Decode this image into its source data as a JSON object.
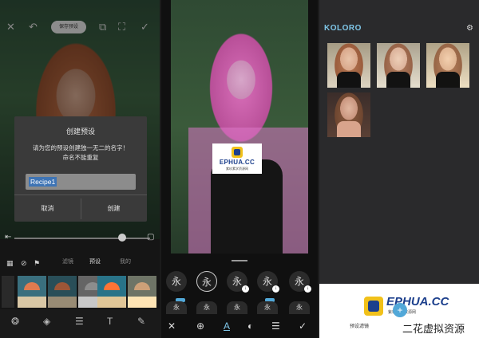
{
  "panel1": {
    "save_preset_pill": "保存预设",
    "dialog": {
      "title": "创建预设",
      "message_line1": "请为您的预设创建独一无二的名字！",
      "message_line2": "命名不能重复",
      "input_value": "Recipe1",
      "cancel_label": "取消",
      "create_label": "创建"
    },
    "tabs": [
      "滤镜",
      "预设",
      "我的"
    ]
  },
  "panel2": {
    "watermark": {
      "text": "EPHUA.CC",
      "sub": "紫玖素学资源网"
    },
    "fonts_row1": [
      "永",
      "永",
      "永",
      "永",
      "永"
    ],
    "fonts_row2": [
      "永",
      "永",
      "永",
      "永",
      "永"
    ]
  },
  "panel3": {
    "app_title": "KOLORO",
    "promo": {
      "text": "EPHUA.CC",
      "sub": "紫玖素学资源网",
      "button_label": "预设滤镜",
      "credit": "二花虚拟资源"
    }
  },
  "colors": {
    "accent": "#52a8d8",
    "title": "#7fc6e8",
    "brand_blue": "#1c3f8c",
    "brand_yellow": "#f1c11a"
  }
}
